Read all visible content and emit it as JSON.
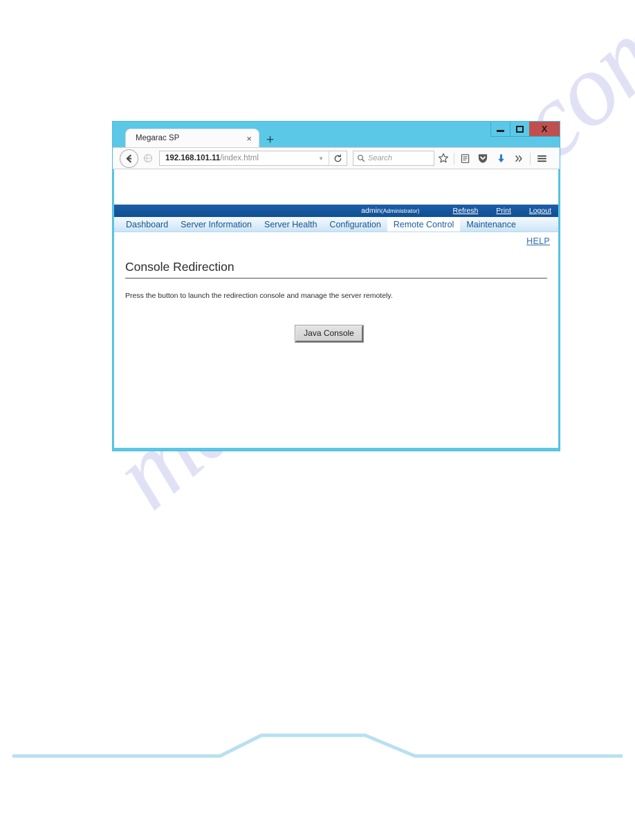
{
  "browser": {
    "tab": {
      "title": "Megarac SP",
      "close_label": "×",
      "new_tab_label": "+"
    },
    "window_controls": {
      "minimize": "–",
      "maximize": "□",
      "close": "X"
    },
    "toolbar": {
      "back_icon": "←",
      "forward_icon": "←",
      "url_host": "192.168.101.11",
      "url_path": "/index.html",
      "url_full": "192.168.101.11/index.html",
      "dropdown_icon": "▼",
      "reload_icon": "⟳",
      "search_placeholder": "Search",
      "bookmark_icon": "☆",
      "library_icon": "☷",
      "pocket_icon": "♥",
      "download_icon": "↓",
      "overflow_icon": "»",
      "menu_icon": "☰"
    }
  },
  "app": {
    "admin_bar": {
      "user_name": "admin",
      "user_role": "(Administrator)",
      "links": [
        {
          "label": "Refresh"
        },
        {
          "label": "Print"
        },
        {
          "label": "Logout"
        }
      ]
    },
    "main_nav": {
      "tabs": [
        {
          "label": "Dashboard",
          "active": false
        },
        {
          "label": "Server Information",
          "active": false
        },
        {
          "label": "Server Health",
          "active": false
        },
        {
          "label": "Configuration",
          "active": false
        },
        {
          "label": "Remote Control",
          "active": true
        },
        {
          "label": "Maintenance",
          "active": false
        }
      ]
    },
    "help_link": "HELP",
    "page": {
      "title": "Console Redirection",
      "description": "Press the button to launch the redirection console and manage the server remotely.",
      "primary_button": "Java Console"
    }
  },
  "watermark": {
    "text": "manualshive.com"
  },
  "colors": {
    "browser_chrome": "#5bc8e8",
    "admin_bar": "#1b5ea8",
    "nav_text": "#18548c",
    "help_link": "#2f6fad",
    "close_button": "#c0504d",
    "watermark": "#c9c9ef",
    "footer_decor": "#b8e0f0"
  }
}
